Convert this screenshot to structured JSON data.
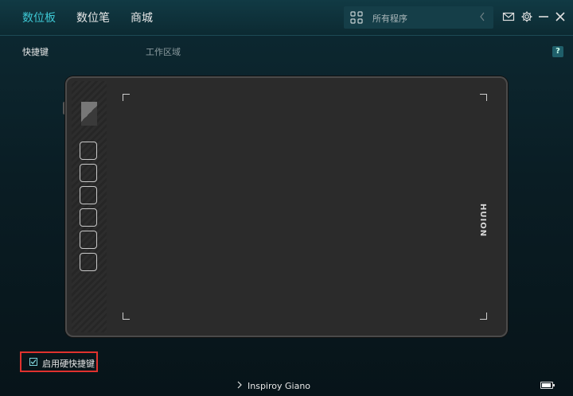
{
  "tabs": [
    "数位板",
    "数位笔",
    "商城"
  ],
  "active_tab": 0,
  "search": {
    "placeholder": "所有程序",
    "icon": "app-grid-icon"
  },
  "window_controls": [
    "mail-icon",
    "gear-icon",
    "minimize-icon",
    "close-icon"
  ],
  "subnav": {
    "shortcut_label": "快捷键",
    "work_area_label": "工作区域"
  },
  "help_label": "?",
  "tablet": {
    "brand": "HUION",
    "key_count": 6
  },
  "shortcut_toggle": {
    "label": "启用硬快捷键",
    "checked": true
  },
  "device": {
    "name": "Inspiroy Giano"
  },
  "battery": {
    "level": 0.9
  },
  "colors": {
    "accent": "#3ec8d4",
    "highlight": "#e0322e",
    "background": "#0a1d24"
  }
}
